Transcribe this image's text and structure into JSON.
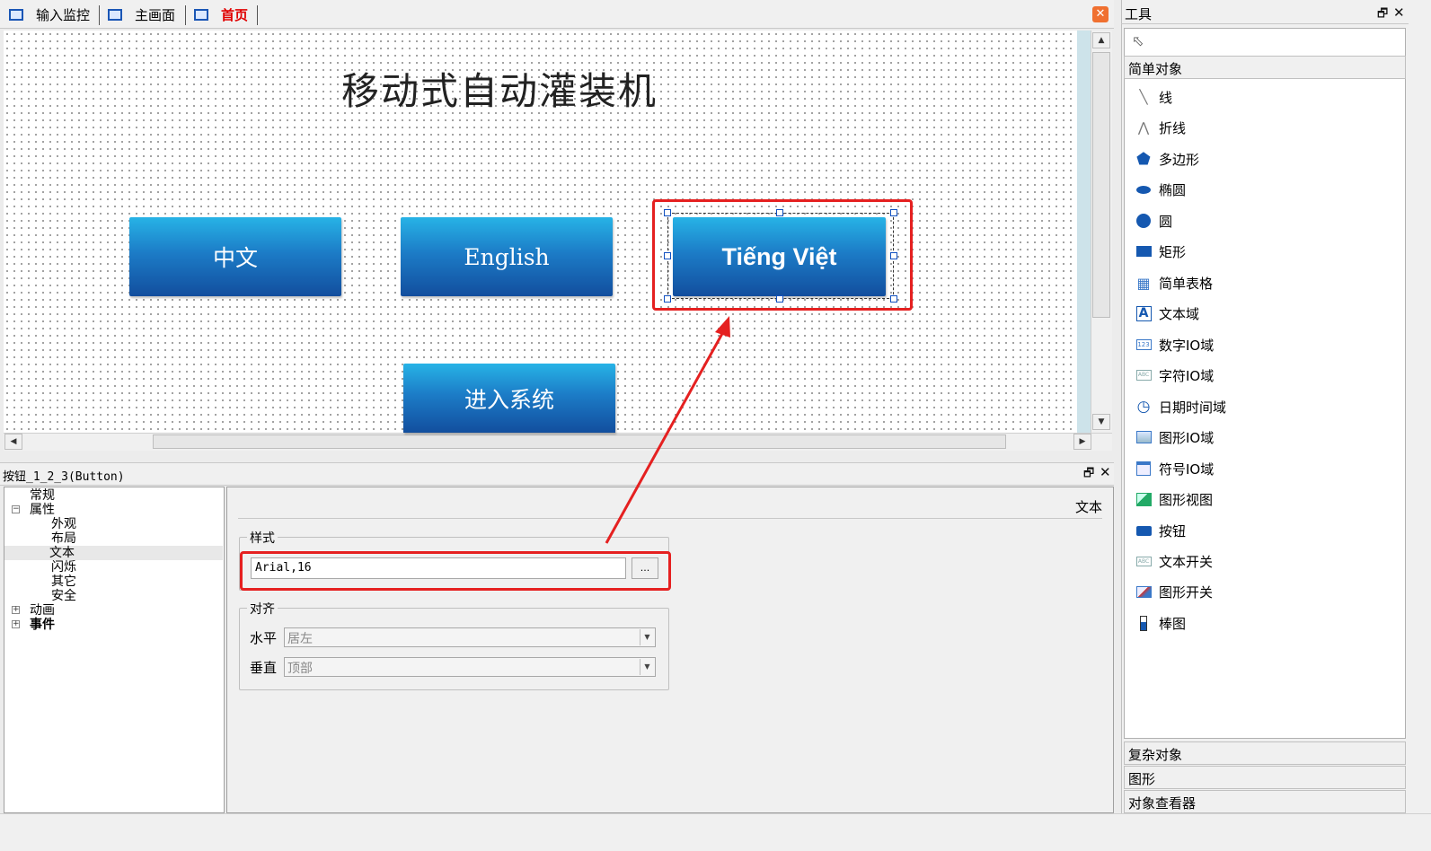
{
  "tabs": [
    {
      "label": "输入监控"
    },
    {
      "label": "主画面"
    },
    {
      "label": "首页"
    }
  ],
  "screen": {
    "title": "移动式自动灌装机",
    "buttons": {
      "chinese": "中文",
      "english": "English",
      "vietnamese": "Tiếng Việt",
      "enter": "进入系统"
    }
  },
  "props": {
    "header": "按钮_1_2_3(Button)",
    "tree": {
      "general": "常规",
      "properties": "属性",
      "appearance": "外观",
      "layout": "布局",
      "text": "文本",
      "flash": "闪烁",
      "other": "其它",
      "security": "安全",
      "animation": "动画",
      "events": "事件"
    },
    "section_title": "文本",
    "style_group": "样式",
    "style_value": "Arial,16",
    "browse": "...",
    "align_group": "对齐",
    "horizontal_label": "水平",
    "horizontal_value": "居左",
    "vertical_label": "垂直",
    "vertical_value": "顶部"
  },
  "tools": {
    "title": "工具",
    "simple_objects": "简单对象",
    "items": [
      "线",
      "折线",
      "多边形",
      "椭圆",
      "圆",
      "矩形",
      "简单表格",
      "文本域",
      "数字IO域",
      "字符IO域",
      "日期时间域",
      "图形IO域",
      "符号IO域",
      "图形视图",
      "按钮",
      "文本开关",
      "图形开关",
      "棒图"
    ],
    "complex_objects": "复杂对象",
    "graphics": "图形",
    "object_viewer": "对象查看器"
  },
  "colors": {
    "highlight": "#e52020",
    "button_top": "#27b3e6",
    "button_bottom": "#124e9e",
    "active_tab": "#e00000"
  }
}
